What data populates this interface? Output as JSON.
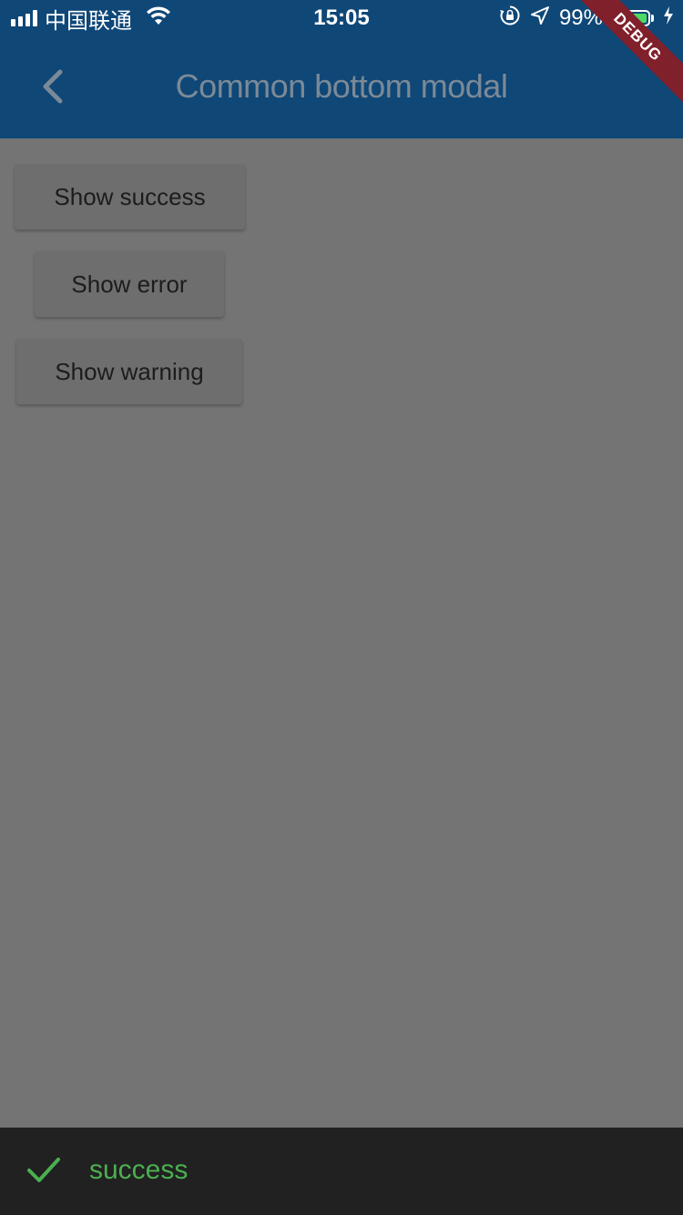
{
  "status_bar": {
    "carrier": "中国联通",
    "time": "15:05",
    "battery_percent": "99%",
    "battery_level": 0.99,
    "battery_color": "#4cd964",
    "icons": [
      "signal-icon",
      "wifi-icon",
      "orientation-lock-icon",
      "location-icon",
      "battery-icon",
      "charging-icon"
    ]
  },
  "app_bar": {
    "title": "Common bottom modal",
    "back_icon": "chevron-left-icon",
    "background": "#0f4777"
  },
  "debug_banner": {
    "label": "DEBUG",
    "color": "#80202b"
  },
  "buttons": {
    "success_label": "Show success",
    "error_label": "Show error",
    "warning_label": "Show warning"
  },
  "bottom_modal": {
    "icon": "check-icon",
    "message": "success",
    "accent_color": "#4caf50",
    "background": "#212121"
  }
}
